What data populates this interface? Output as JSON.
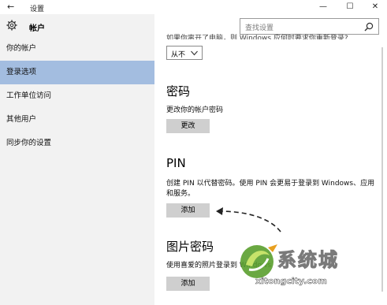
{
  "window": {
    "title": "设置",
    "back_glyph": "←",
    "minimize_glyph": "—",
    "maximize_glyph": "☐",
    "close_glyph": "✕"
  },
  "header": {
    "section_title": "帐户"
  },
  "search": {
    "placeholder": "查找设置"
  },
  "sidebar": {
    "items": [
      {
        "label": "你的帐户"
      },
      {
        "label": "登录选项",
        "selected": true
      },
      {
        "label": "工作单位访问"
      },
      {
        "label": "其他用户"
      },
      {
        "label": "同步你的设置"
      }
    ]
  },
  "main": {
    "truncated_text": "如果你离开了电脑，则 Windows 应何时要求你重新登录?",
    "dropdown_value": "从不",
    "password": {
      "heading": "密码",
      "description": "更改你的帐户密码",
      "button": "更改"
    },
    "pin": {
      "heading": "PIN",
      "description": "创建 PIN 以代替密码。使用 PIN 会更易于登录到 Windows、应用和服务。",
      "button": "添加"
    },
    "picture_password": {
      "heading": "图片密码",
      "description": "使用喜爱的照片登录到 Windows",
      "button": "添加"
    }
  },
  "watermark": {
    "text_cn": "系统城",
    "text_en": "xitongcity.com"
  },
  "colors": {
    "selected_nav": "#a3bde0",
    "sidebar_bg": "#f2f2f2",
    "button_bg": "#cfcfcf"
  }
}
